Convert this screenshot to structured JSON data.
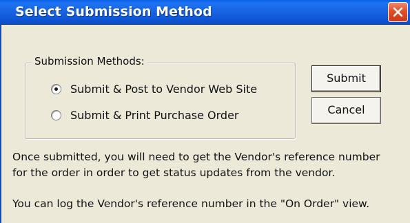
{
  "window": {
    "title": "Select Submission Method",
    "close_icon": "close-icon"
  },
  "group": {
    "legend": "Submission Methods:",
    "options": [
      {
        "label": "Submit & Post to Vendor Web Site",
        "checked": true
      },
      {
        "label": "Submit & Print Purchase Order",
        "checked": false
      }
    ]
  },
  "buttons": {
    "submit_label": "Submit",
    "cancel_label": "Cancel"
  },
  "message": {
    "line1": "Once submitted, you will need to get the Vendor's reference number",
    "line2": "for the order in order to get status updates from the vendor.",
    "line3": "You can log the Vendor's reference number in the \"On Order\" view."
  },
  "colors": {
    "title_bar": "#1a67e6",
    "close_button": "#e0502a",
    "dialog_background": "#ece9d8"
  }
}
